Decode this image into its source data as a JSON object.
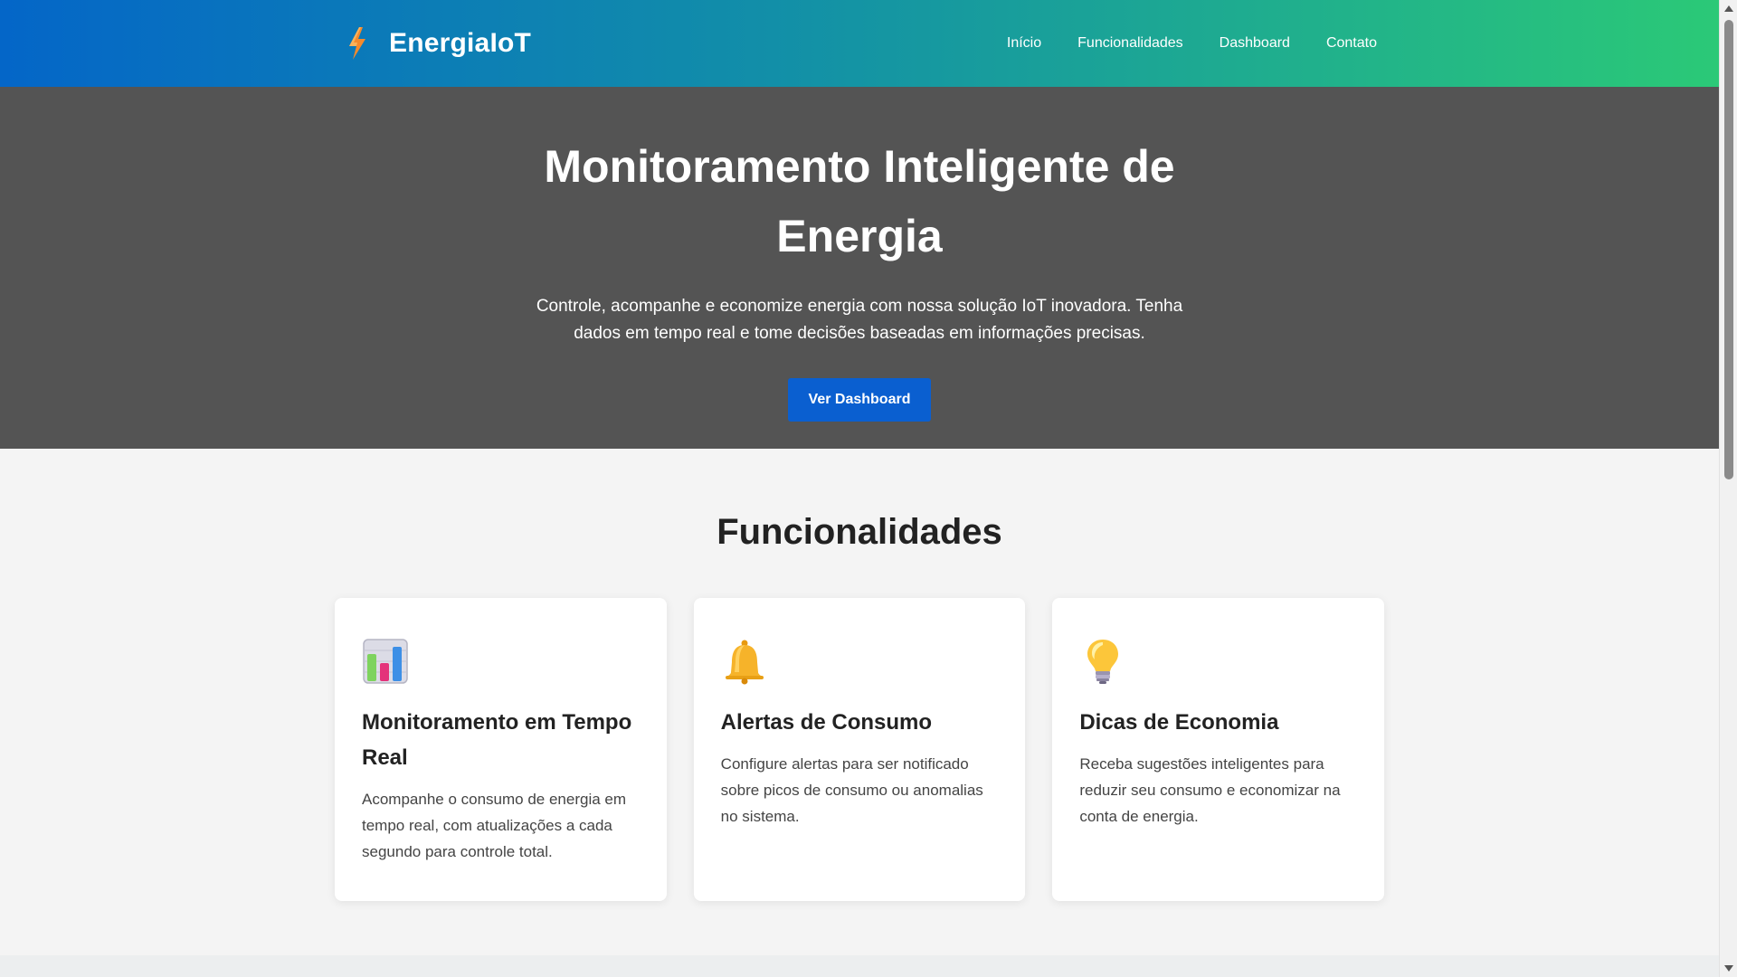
{
  "header": {
    "brand": "EnergiaIoT",
    "nav": [
      "Início",
      "Funcionalidades",
      "Dashboard",
      "Contato"
    ]
  },
  "hero": {
    "title": "Monitoramento Inteligente de Energia",
    "subtitle": "Controle, acompanhe e economize energia com nossa solução IoT inovadora. Tenha dados em tempo real e tome decisões baseadas em informações precisas.",
    "button": "Ver Dashboard"
  },
  "features": {
    "title": "Funcionalidades",
    "cards": [
      {
        "icon": "bar-chart-icon",
        "title": "Monitoramento em Tempo Real",
        "text": "Acompanhe o consumo de energia em tempo real, com atualizações a cada segundo para controle total."
      },
      {
        "icon": "bell-icon",
        "title": "Alertas de Consumo",
        "text": "Configure alertas para ser notificado sobre picos de consumo ou anomalias no sistema."
      },
      {
        "icon": "light-bulb-icon",
        "title": "Dicas de Economia",
        "text": "Receba sugestões inteligentes para reduzir seu consumo e economizar na conta de energia."
      }
    ]
  },
  "colors": {
    "header_gradient_start": "#0466c8",
    "header_gradient_end": "#2bc977",
    "hero_background": "#545454",
    "primary_button": "#0a5fd0",
    "bolt": "#f58a2c"
  }
}
